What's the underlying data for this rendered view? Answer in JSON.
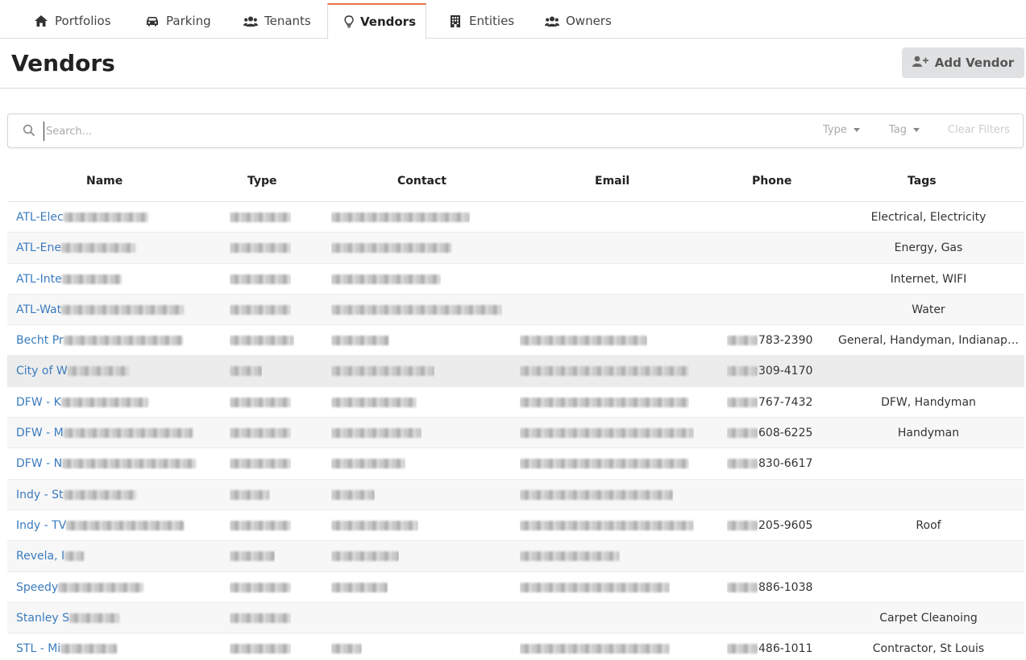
{
  "tabs": [
    {
      "label": "Portfolios",
      "icon": "home-icon"
    },
    {
      "label": "Parking",
      "icon": "car-icon"
    },
    {
      "label": "Tenants",
      "icon": "users-icon"
    },
    {
      "label": "Vendors",
      "icon": "lightbulb-icon"
    },
    {
      "label": "Entities",
      "icon": "building-icon"
    },
    {
      "label": "Owners",
      "icon": "users-icon"
    }
  ],
  "header": {
    "title": "Vendors",
    "add_label": "Add Vendor"
  },
  "search": {
    "placeholder": "Search...",
    "type_label": "Type",
    "tag_label": "Tag",
    "clear_label": "Clear Filters"
  },
  "columns": [
    "Name",
    "Type",
    "Contact",
    "Email",
    "Phone",
    "Tags"
  ],
  "rows": [
    {
      "name": "ATL-Elec",
      "phone": "",
      "tags": "Electrical, Electricity"
    },
    {
      "name": "ATL-Ene",
      "phone": "",
      "tags": "Energy, Gas"
    },
    {
      "name": "ATL-Inte",
      "phone": "",
      "tags": "Internet, WIFI"
    },
    {
      "name": "ATL-Wat",
      "phone": "",
      "tags": "Water"
    },
    {
      "name": "Becht Pr",
      "phone": "783-2390",
      "tags": "General, Handyman, Indianap…"
    },
    {
      "name": "City of W",
      "phone": "309-4170",
      "tags": ""
    },
    {
      "name": "DFW - K",
      "phone": "767-7432",
      "tags": "DFW, Handyman"
    },
    {
      "name": "DFW - M",
      "phone": "608-6225",
      "tags": "Handyman"
    },
    {
      "name": "DFW - N",
      "phone": "830-6617",
      "tags": ""
    },
    {
      "name": "Indy - St",
      "phone": "",
      "tags": ""
    },
    {
      "name": "Indy - TV",
      "phone": "205-9605",
      "tags": "Roof"
    },
    {
      "name": "Revela, I",
      "phone": "",
      "tags": ""
    },
    {
      "name": "Speedy",
      "phone": "886-1038",
      "tags": ""
    },
    {
      "name": "Stanley S",
      "phone": "",
      "tags": "Carpet Cleanoing"
    },
    {
      "name": "STL - Mi",
      "phone": "486-1011",
      "tags": "Contractor, St Louis"
    }
  ]
}
